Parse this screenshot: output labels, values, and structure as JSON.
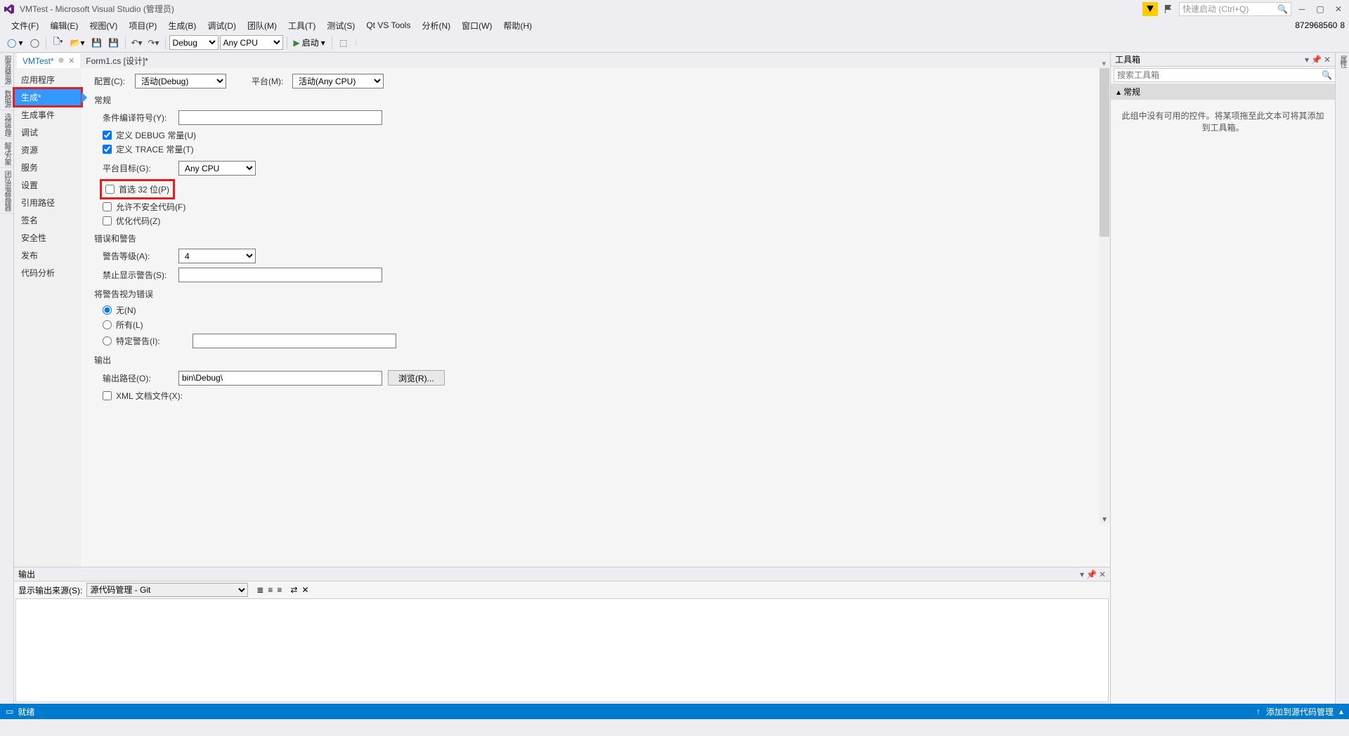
{
  "title": "VMTest - Microsoft Visual Studio (管理员)",
  "menubar": [
    "文件(F)",
    "编辑(E)",
    "视图(V)",
    "项目(P)",
    "生成(B)",
    "调试(D)",
    "团队(M)",
    "工具(T)",
    "测试(S)",
    "Qt VS Tools",
    "分析(N)",
    "窗口(W)",
    "帮助(H)"
  ],
  "toolbar": {
    "config": "Debug",
    "platform": "Any CPU",
    "start": "启动"
  },
  "search_placeholder": "快速启动 (Ctrl+Q)",
  "user_number": "872968560",
  "user_badge": "8",
  "left_rail": [
    "服务器资源",
    "数据源",
    "选项管理",
    "解决方案",
    "团队资源管理器"
  ],
  "tabs": [
    {
      "label": "VMTest*",
      "active": true,
      "pinned": true
    },
    {
      "label": "Form1.cs [设计]*",
      "active": false
    }
  ],
  "pp_sidebar": [
    "应用程序",
    "生成*",
    "生成事件",
    "调试",
    "资源",
    "服务",
    "设置",
    "引用路径",
    "签名",
    "安全性",
    "发布",
    "代码分析"
  ],
  "pp_active_idx": 1,
  "config_row": {
    "config_label": "配置(C):",
    "config_val": "活动(Debug)",
    "platform_label": "平台(M):",
    "platform_val": "活动(Any CPU)"
  },
  "groups": {
    "general": "常规",
    "cond_symbol_label": "条件编译符号(Y):",
    "cond_symbol_val": "",
    "debug_const": "定义 DEBUG 常量(U)",
    "trace_const": "定义 TRACE 常量(T)",
    "platform_target_label": "平台目标(G):",
    "platform_target_val": "Any CPU",
    "prefer32": "首选 32 位(P)",
    "unsafe": "允许不安全代码(F)",
    "optimize": "优化代码(Z)",
    "errwarn": "错误和警告",
    "warn_level_label": "警告等级(A):",
    "warn_level_val": "4",
    "suppress_label": "禁止显示警告(S):",
    "suppress_val": "",
    "treat_as_err": "将警告视为错误",
    "none": "无(N)",
    "all": "所有(L)",
    "specific": "特定警告(I):",
    "specific_val": "",
    "output": "输出",
    "out_path_label": "输出路径(O):",
    "out_path_val": "bin\\Debug\\",
    "browse": "浏览(R)...",
    "xml_doc": "XML 文档文件(X):"
  },
  "output_panel": {
    "title": "输出",
    "show_from": "显示输出来源(S):",
    "source": "源代码管理 - Git"
  },
  "toolbox": {
    "title": "工具箱",
    "search_placeholder": "搜索工具箱",
    "group": "常规",
    "empty": "此组中没有可用的控件。将某项拖至此文本可将其添加到工具箱。"
  },
  "right_rail": [
    "属性"
  ],
  "status": {
    "ready": "就绪",
    "add_src": "添加到源代码管理"
  }
}
